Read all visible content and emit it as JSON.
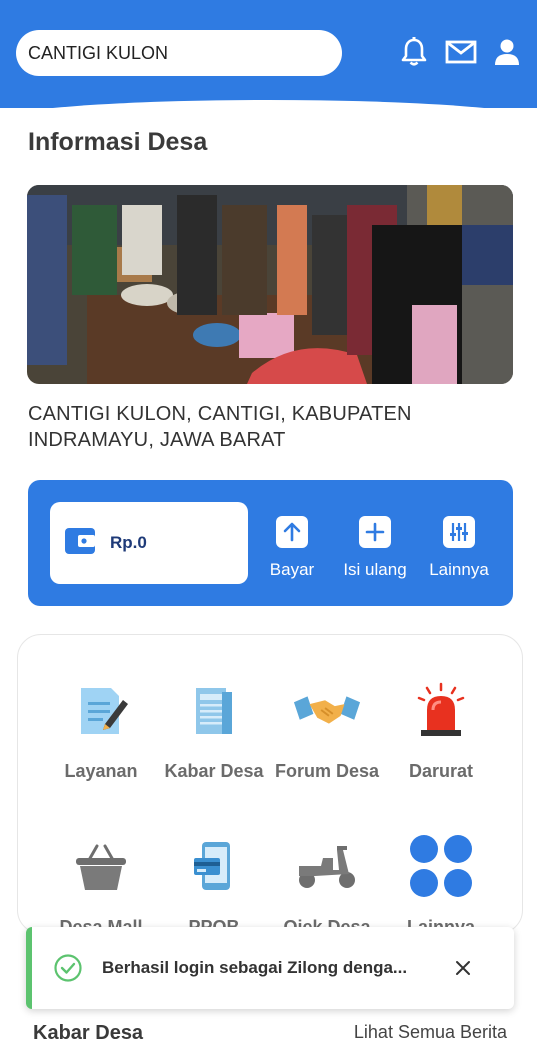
{
  "header": {
    "village_name": "CANTIGI KULON",
    "icons": [
      "bell-icon",
      "mail-icon",
      "user-icon"
    ],
    "color": "#2f7be2"
  },
  "info": {
    "title": "Informasi Desa",
    "address": "CANTIGI KULON, CANTIGI, KABUPATEN INDRAMAYU, JAWA BARAT"
  },
  "wallet": {
    "balance": "Rp.0",
    "actions": [
      {
        "label": "Bayar",
        "icon": "arrow-up-icon"
      },
      {
        "label": "Isi ulang",
        "icon": "plus-icon"
      },
      {
        "label": "Lainnya",
        "icon": "sliders-icon"
      }
    ]
  },
  "menu": {
    "items": [
      {
        "label": "Layanan",
        "icon": "document-edit-icon"
      },
      {
        "label": "Kabar Desa",
        "icon": "newspaper-icon"
      },
      {
        "label": "Forum Desa",
        "icon": "handshake-icon"
      },
      {
        "label": "Darurat",
        "icon": "siren-icon"
      },
      {
        "label": "Desa Mall",
        "icon": "basket-icon"
      },
      {
        "label": "PPOB",
        "icon": "phone-payment-icon"
      },
      {
        "label": "Ojek Desa",
        "icon": "scooter-icon"
      },
      {
        "label": "Lainnya",
        "icon": "more-dots-icon"
      }
    ]
  },
  "toast": {
    "message": "Berhasil login sebagai Zilong denga...",
    "accent": "#5cc36f"
  },
  "news": {
    "title": "Kabar Desa",
    "see_all": "Lihat Semua Berita"
  }
}
